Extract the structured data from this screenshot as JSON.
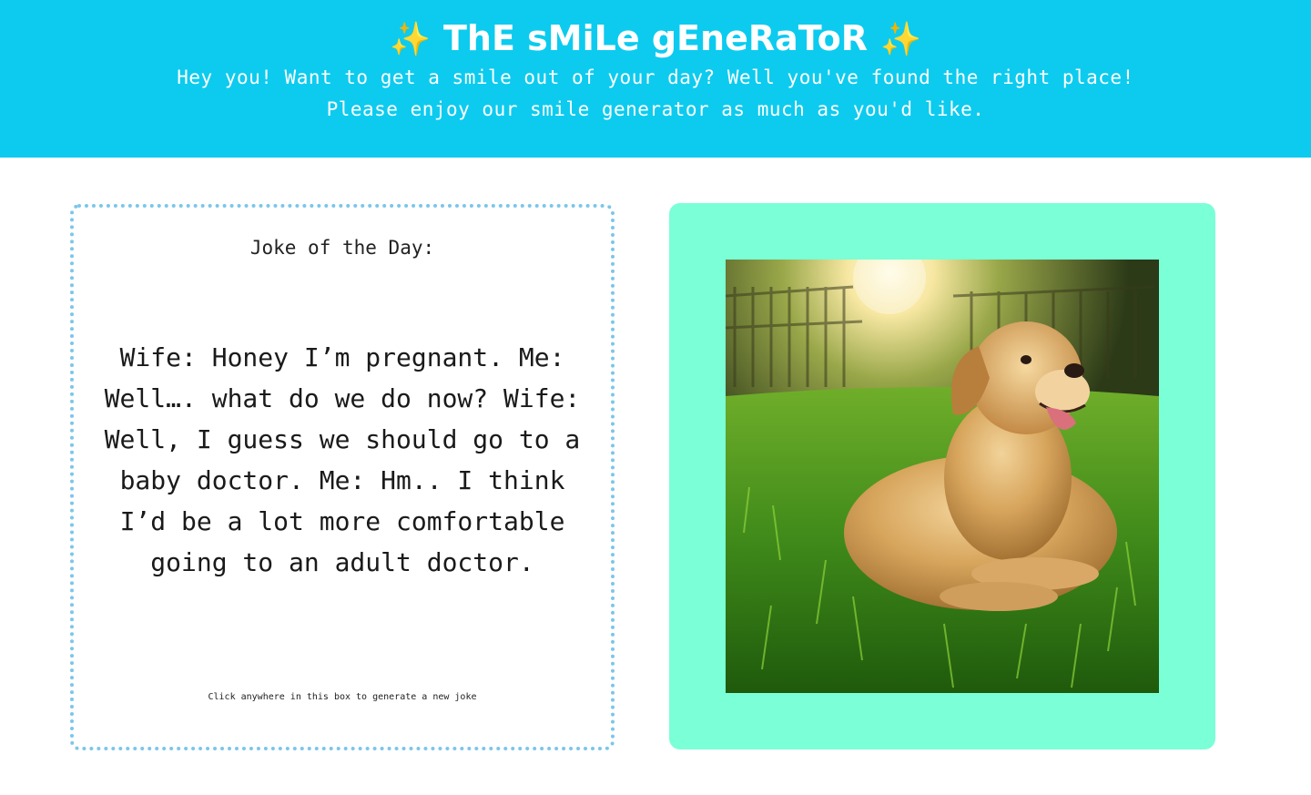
{
  "header": {
    "sparkle_left": "✨",
    "title": "ThE sMiLe gEneRaToR",
    "sparkle_right": "✨",
    "subtitle_line1": "Hey you! Want to get a smile out of your day? Well you've found the right place!",
    "subtitle_line2": "Please enjoy our smile generator as much as you'd like."
  },
  "joke": {
    "heading": "Joke of the Day:",
    "text": "Wife: Honey I’m pregnant. Me: Well…. what do we do now? Wife: Well, I guess we should go to a baby doctor. Me: Hm.. I think I’d be a lot more comfortable going to an adult doctor.",
    "hint": "Click anywhere in this box to generate a new joke"
  },
  "colors": {
    "header_bg": "#0ccbef",
    "frame_bg": "#7bffd6",
    "dotted_border": "#7cc6ea",
    "sparkle": "#ffd43b"
  },
  "photo": {
    "subject": "golden retriever lying in sunlit grass"
  }
}
